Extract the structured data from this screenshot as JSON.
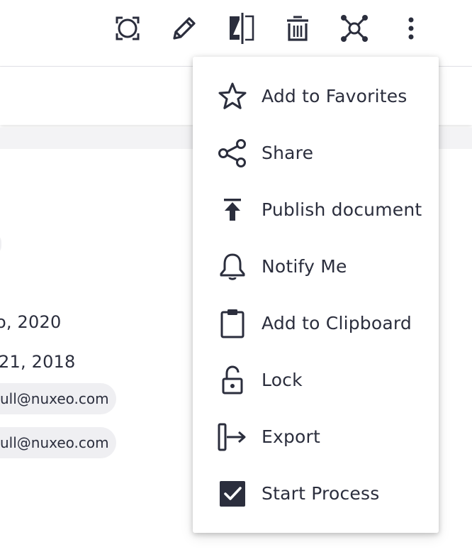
{
  "toolbar": {
    "icons": [
      "focus-frame-icon",
      "edit-pencil-icon",
      "compare-icon",
      "delete-trash-icon",
      "workflow-graph-icon",
      "more-vertical-icon"
    ]
  },
  "details": {
    "date_modified_fragment": "o, 2020",
    "date_created_fragment": " 21, 2018",
    "user_chip_1": "ull@nuxeo.com",
    "user_chip_2": "ull@nuxeo.com"
  },
  "menu": {
    "items": [
      {
        "label": "Add to Favorites",
        "icon": "star-icon"
      },
      {
        "label": "Share",
        "icon": "share-icon"
      },
      {
        "label": "Publish document",
        "icon": "publish-upload-icon"
      },
      {
        "label": "Notify Me",
        "icon": "bell-icon"
      },
      {
        "label": "Add to Clipboard",
        "icon": "clipboard-icon"
      },
      {
        "label": "Lock",
        "icon": "unlocked-padlock-icon"
      },
      {
        "label": "Export",
        "icon": "export-icon"
      },
      {
        "label": "Start Process",
        "icon": "checkbox-checked-icon"
      }
    ]
  },
  "colors": {
    "icon": "#2b2e3d",
    "text": "#2b2e3d",
    "chip_bg": "#efeff2",
    "band_bg": "#f3f3f5"
  }
}
